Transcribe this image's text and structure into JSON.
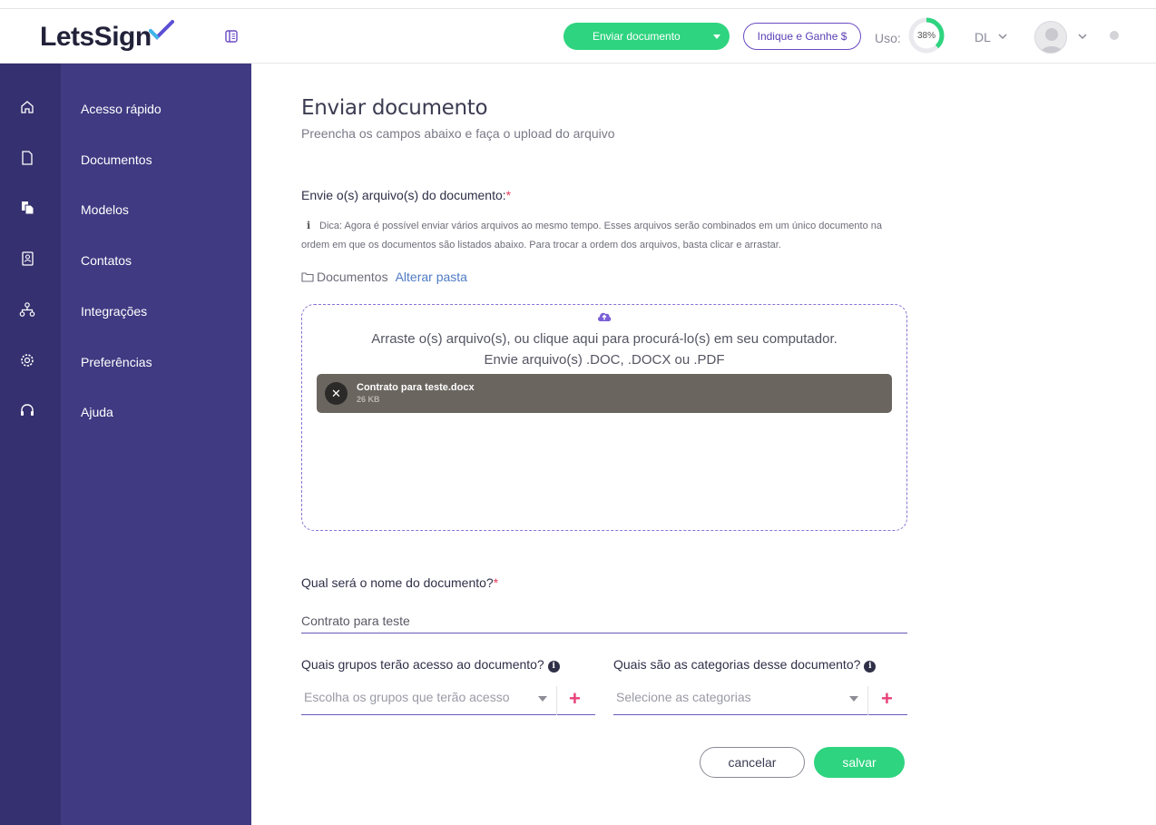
{
  "app": {
    "logo_text": "LetsSign",
    "colors": {
      "accent": "#2ed47f",
      "brand_purple": "#3f3a82",
      "rail_purple": "#35306f",
      "required": "#e53d5c"
    }
  },
  "header": {
    "send_button": "Enviar documento",
    "refer_button": "Indique e Ganhe $",
    "usage_label": "Uso:",
    "usage_percent": "38%",
    "usage_value": 0.38,
    "user_initials": "DL"
  },
  "sidebar": {
    "items": [
      {
        "label": "Acesso rápido",
        "icon": "home-icon"
      },
      {
        "label": "Documentos",
        "icon": "document-icon"
      },
      {
        "label": "Modelos",
        "icon": "templates-icon"
      },
      {
        "label": "Contatos",
        "icon": "contacts-icon"
      },
      {
        "label": "Integrações",
        "icon": "integrations-icon"
      },
      {
        "label": "Preferências",
        "icon": "gear-icon"
      },
      {
        "label": "Ajuda",
        "icon": "headset-icon"
      }
    ]
  },
  "main": {
    "title": "Enviar documento",
    "subtitle": "Preencha os campos abaixo e faça o upload do arquivo",
    "files_label": "Envie o(s) arquivo(s) do documento:",
    "required_mark": "*",
    "tip": "Dica: Agora é possível enviar vários arquivos ao mesmo tempo. Esses arquivos serão combinados em um único documento na ordem em que os documentos são listados abaixo. Para trocar a ordem dos arquivos, basta clicar e arrastar.",
    "folder_name": "Documentos",
    "change_folder": "Alterar pasta",
    "dropzone": {
      "line1": "Arraste o(s) arquivo(s), ou clique aqui para procurá-lo(s) em seu computador.",
      "line2": "Envie arquivo(s) .DOC, .DOCX ou .PDF",
      "files": [
        {
          "name": "Contrato para teste.docx",
          "size": "26 KB"
        }
      ]
    },
    "name_label": "Qual será o nome do documento?",
    "name_value": "Contrato para teste",
    "groups_label": "Quais grupos terão acesso ao documento?",
    "groups_placeholder": "Escolha os grupos que terão acesso",
    "categories_label": "Quais são as categorias desse documento?",
    "categories_placeholder": "Selecione as categorias",
    "cancel_button": "cancelar",
    "save_button": "salvar"
  }
}
